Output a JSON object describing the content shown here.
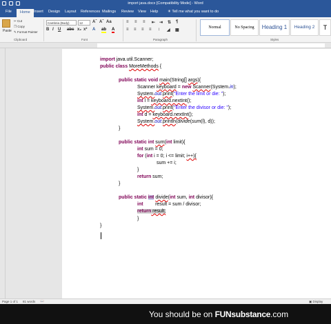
{
  "window": {
    "title": "import java.docx [Compatibility Mode] - Word"
  },
  "ribbon_tabs": [
    "File",
    "Home",
    "Insert",
    "Design",
    "Layout",
    "References",
    "Mailings",
    "Review",
    "View",
    "Help"
  ],
  "tell_me": "Tell me what you want to do",
  "clipboard": {
    "paste": "Paste",
    "cut": "Cut",
    "copy": "Copy",
    "format_painter": "Format Painter",
    "label": "Clipboard"
  },
  "font": {
    "name": "Cambria (Body)",
    "size": "12",
    "label": "Font"
  },
  "paragraph_label": "Paragraph",
  "styles": {
    "items": [
      "Normal",
      "No Spacing",
      "Heading 1",
      "Heading 2"
    ],
    "label": "Styles"
  },
  "document": {
    "l1a": "import",
    "l1b": " java.util.Scanner;",
    "l2a": "public",
    "l2b": " ",
    "l2c": "class",
    "l2d": " ",
    "l2e": "MoreMethods",
    "l2f": " {",
    "m1a": "public static void",
    "m1b": " ",
    "m1c": "main",
    "m1d": "(String[] ",
    "m1e": "args",
    "m1f": "){",
    "s1a": "Scanner ",
    "s1b": "keyboard",
    "s1c": " = ",
    "s1d": "new",
    "s1e": " ",
    "s1f": "Scanner",
    "s1g": "(System.",
    "s1h": "in",
    "s1i": ");",
    "s2a": "System.",
    "s2b": "out",
    "s2c": ".",
    "s2d": "print",
    "s2e": "(",
    "s2f": "\"Enter the limit or die: \"",
    "s2g": ");",
    "s3a": "int",
    "s3b": " l = ",
    "s3c": "keyboard.nextInt",
    "s3d": "();",
    "s4a": "System.",
    "s4b": "out",
    "s4c": ".",
    "s4d": "print",
    "s4e": "(",
    "s4f": "\"Enter the divisor or die: \"",
    "s4g": ");",
    "s5a": "int",
    "s5b": " d = ",
    "s5c": "keyboard.nextInt",
    "s5d": "();",
    "s6a": "System.",
    "s6b": "out",
    "s6c": ".",
    "s6d": "println",
    "s6e": "(",
    "s6f": "divide",
    "s6g": "(",
    "s6h": "sum",
    "s6i": "(l), d));",
    "c1": "}",
    "m2a": "public static int",
    "m2b": " ",
    "m2c": "sum",
    "m2d": "(",
    "m2e": "int",
    "m2f": " limit){",
    "t1a": "int",
    "t1b": " sum = 0;",
    "t2a": "for",
    "t2b": " (",
    "t2c": "int",
    "t2d": " i = 0; i <= limit; ",
    "t2e": "i++){",
    "t3": "sum += i;",
    "t4": "}",
    "t5a": "return",
    "t5b": " sum;",
    "c2": "}",
    "m3a": "public static",
    "m3b": " ",
    "m3c": "int",
    "m3d": " ",
    "m3e": "divide",
    "m3f": "(",
    "m3g": "int",
    "m3h": " sum, ",
    "m3i": "int",
    "m3j": " divisor){",
    "u1a": "int",
    "u1b": "         result = sum / divisor;",
    "u2a": "return",
    "u2b": " result;",
    "c3": "}",
    "c4": "}"
  },
  "status": {
    "page": "Page 1 of 1",
    "words": "81 words",
    "display_settings": "Display Settings"
  },
  "watermark": {
    "prefix": "You should be on ",
    "brand": "FUNsubstance",
    "suffix": ".com"
  }
}
